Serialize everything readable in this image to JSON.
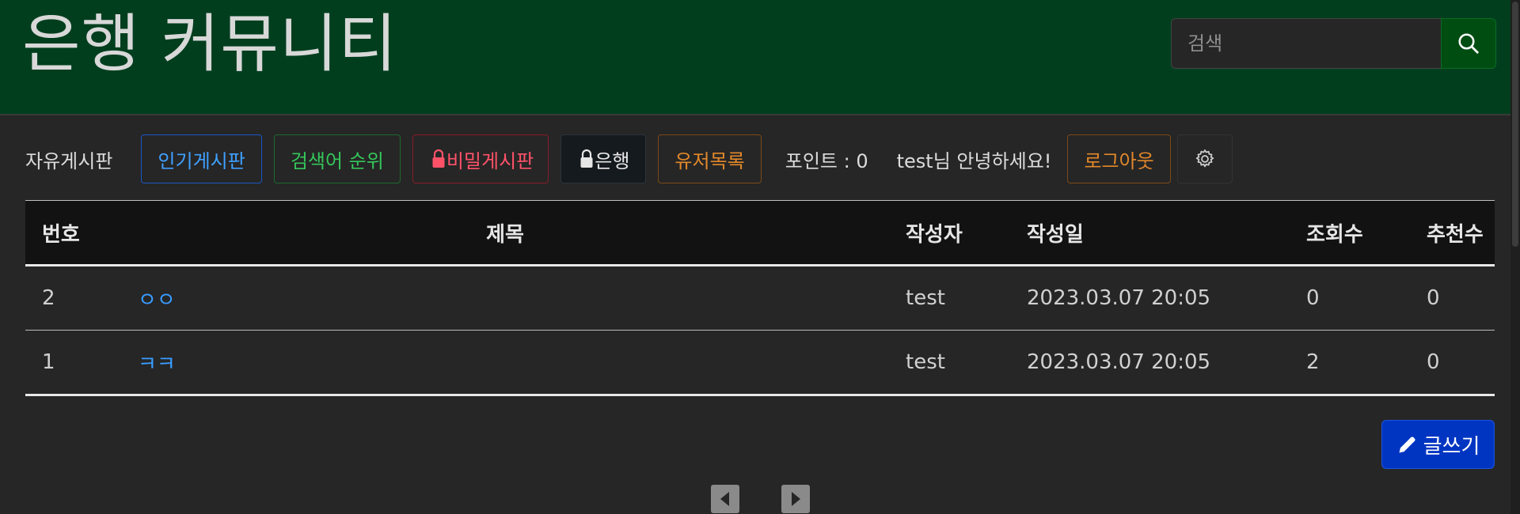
{
  "header": {
    "title": "은행 커뮤니티",
    "search_placeholder": "검색",
    "search_icon": "search-icon",
    "bg_color": "#003e1e"
  },
  "nav": {
    "free_board": "자유게시판",
    "popular_board": "인기게시판",
    "search_rank": "검색어 순위",
    "secret_board": "비밀게시판",
    "bank": "은행",
    "user_list": "유저목록",
    "points": "포인트 : 0",
    "greeting": "test님 안녕하세요!",
    "logout": "로그아웃",
    "settings_icon": "gear-icon",
    "lock_icon": "lock-icon"
  },
  "table": {
    "headers": [
      "번호",
      "제목",
      "작성자",
      "작성일",
      "조회수",
      "추천수"
    ],
    "rows": [
      {
        "no": "2",
        "title": "ㅇㅇ",
        "author": "test",
        "date": "2023.03.07 20:05",
        "views": "0",
        "likes": "0"
      },
      {
        "no": "1",
        "title": "ㅋㅋ",
        "author": "test",
        "date": "2023.03.07 20:05",
        "views": "2",
        "likes": "0"
      }
    ]
  },
  "write_button": {
    "label": "글쓰기",
    "icon": "pencil-icon",
    "color": "#0035c2"
  },
  "pagination": {
    "prev_icon": "prev-page-icon",
    "next_icon": "next-page-icon"
  }
}
